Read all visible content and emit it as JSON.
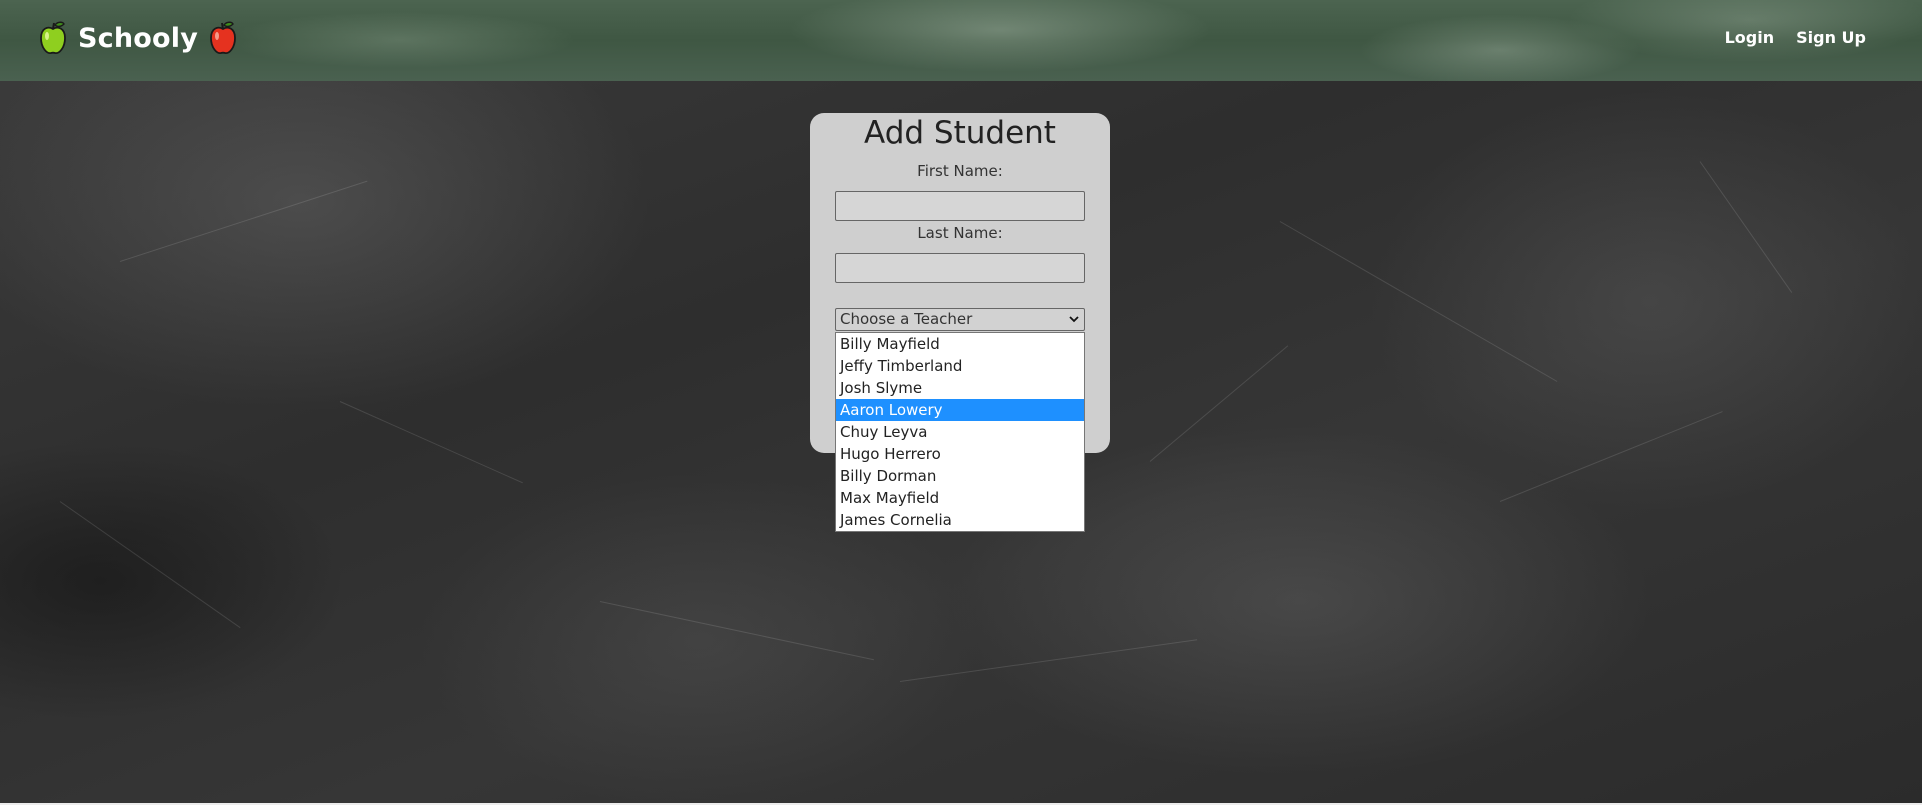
{
  "navbar": {
    "brand": "Schooly",
    "links": [
      {
        "label": "Login"
      },
      {
        "label": "Sign Up"
      }
    ]
  },
  "form": {
    "title": "Add Student",
    "first_name_label": "First Name:",
    "first_name_value": "",
    "last_name_label": "Last Name:",
    "last_name_value": "",
    "teacher_select_value": "Choose a Teacher",
    "teacher_options": [
      "Billy Mayfield",
      "Jeffy Timberland",
      "Josh Slyme",
      "Aaron Lowery",
      "Chuy Leyva",
      "Hugo Herrero",
      "Billy Dorman",
      "Max Mayfield",
      "James Cornelia"
    ],
    "highlighted_option": "Aaron Lowery"
  },
  "colors": {
    "navbar_bg": "#435a47",
    "chalkboard_bg": "#333333",
    "card_bg": "#cfcfcf",
    "option_highlight": "#1e90ff"
  },
  "icons": {
    "brand_left": "green-apple-icon",
    "brand_right": "red-apple-icon",
    "select_chevron": "chevron-down-icon"
  }
}
